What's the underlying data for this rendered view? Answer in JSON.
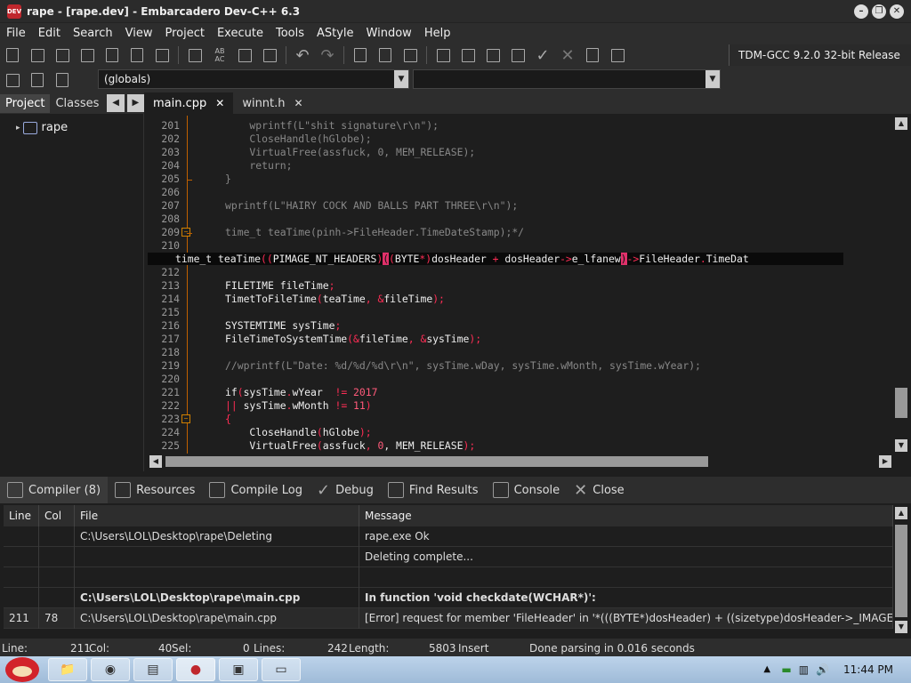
{
  "window": {
    "title": "rape - [rape.dev] - Embarcadero Dev-C++ 6.3",
    "app_icon_text": "DEV C++"
  },
  "menu": [
    "File",
    "Edit",
    "Search",
    "View",
    "Project",
    "Execute",
    "Tools",
    "AStyle",
    "Window",
    "Help"
  ],
  "toolbar": {
    "compiler": "TDM-GCC 9.2.0 32-bit Release",
    "scope_combo": "(globals)"
  },
  "left_panel": {
    "tabs": [
      "Project",
      "Classes"
    ],
    "tree_root": "rape"
  },
  "editor": {
    "tabs": [
      {
        "label": "main.cpp",
        "active": true
      },
      {
        "label": "winnt.h",
        "active": false
      }
    ],
    "lines": [
      {
        "n": "201",
        "t": "    wprintf(L\"shit signature\\r\\n\");",
        "cls": "cm"
      },
      {
        "n": "202",
        "t": "    CloseHandle(hGlobe);",
        "cls": "cm"
      },
      {
        "n": "203",
        "t": "    VirtualFree(assfuck, 0, MEM_RELEASE);",
        "cls": "cm"
      },
      {
        "n": "204",
        "t": "    return;",
        "cls": "cm"
      },
      {
        "n": "205",
        "t": "}",
        "cls": "cm"
      },
      {
        "n": "206",
        "t": "",
        "cls": "cm"
      },
      {
        "n": "207",
        "t": "wprintf(L\"HAIRY COCK AND BALLS PART THREE\\r\\n\");",
        "cls": "cm"
      },
      {
        "n": "208",
        "t": "",
        "cls": "cm"
      },
      {
        "n": "209",
        "t": "time_t teaTime(pinh->FileHeader.TimeDateStamp);*/",
        "cls": "cm"
      },
      {
        "n": "210",
        "t": "",
        "cls": ""
      },
      {
        "n": "211",
        "t": "",
        "cls": "hl"
      },
      {
        "n": "212",
        "t": "",
        "cls": ""
      },
      {
        "n": "213",
        "t": "",
        "cls": ""
      },
      {
        "n": "214",
        "t": "",
        "cls": ""
      },
      {
        "n": "215",
        "t": "",
        "cls": ""
      },
      {
        "n": "216",
        "t": "",
        "cls": ""
      },
      {
        "n": "217",
        "t": "",
        "cls": ""
      },
      {
        "n": "218",
        "t": "",
        "cls": ""
      },
      {
        "n": "219",
        "t": "//wprintf(L\"Date: %d/%d/%d\\r\\n\", sysTime.wDay, sysTime.wMonth, sysTime.wYear);",
        "cls": "cm"
      },
      {
        "n": "220",
        "t": "",
        "cls": ""
      },
      {
        "n": "221",
        "t": "",
        "cls": ""
      },
      {
        "n": "222",
        "t": "",
        "cls": ""
      },
      {
        "n": "223",
        "t": "",
        "cls": ""
      },
      {
        "n": "224",
        "t": "",
        "cls": ""
      },
      {
        "n": "225",
        "t": "",
        "cls": ""
      }
    ],
    "line211": {
      "p1": "time_t teaTime",
      "p2": "((",
      "p3": "PIMAGE_NT_HEADERS",
      "p4": ")",
      "p5": "(",
      "p6": "(",
      "p7": "BYTE",
      "p8": "*)",
      "p9": "dosHeader ",
      "p10": "+",
      "p11": " dosHeader",
      "p12": "->",
      "p13": "e_lfanew",
      "p14": ")",
      "p15": "->",
      "p16": "FileHeader",
      "p17": ".",
      "p18": "TimeDat"
    },
    "line213": {
      "a": "FILETIME fileTime",
      "b": ";"
    },
    "line214": {
      "a": "TimetToFileTime",
      "b": "(",
      "c": "teaTime",
      "d": ", &",
      "e": "fileTime",
      "f": ");"
    },
    "line216": {
      "a": "SYSTEMTIME sysTime",
      "b": ";"
    },
    "line217": {
      "a": "FileTimeToSystemTime",
      "b": "(&",
      "c": "fileTime",
      "d": ", &",
      "e": "sysTime",
      "f": ");"
    },
    "line221": {
      "a": "if",
      "b": "(",
      "c": "sysTime",
      "d": ".",
      "e": "wYear  ",
      "f": "!=",
      "g": " 2017"
    },
    "line222": {
      "a": "||",
      "b": " sysTime",
      "c": ".",
      "d": "wMonth ",
      "e": "!=",
      "f": " 11",
      "g": ")"
    },
    "line223": {
      "a": "{"
    },
    "line224": {
      "a": "    CloseHandle",
      "b": "(",
      "c": "hGlobe",
      "d": ");"
    },
    "line225": {
      "a": "    VirtualFree",
      "b": "(",
      "c": "assfuck",
      "d": ", ",
      "e": "0",
      "f": ", MEM_RELEASE",
      "g": ");"
    }
  },
  "bottom_tabs": [
    "Compiler (8)",
    "Resources",
    "Compile Log",
    "Debug",
    "Find Results",
    "Console",
    "Close"
  ],
  "messages": {
    "headers": [
      "Line",
      "Col",
      "File",
      "Message"
    ],
    "rows": [
      {
        "line": "",
        "col": "",
        "file": "C:\\Users\\LOL\\Desktop\\rape\\Deleting",
        "msg": "rape.exe Ok",
        "bold": false
      },
      {
        "line": "",
        "col": "",
        "file": "",
        "msg": "Deleting complete...",
        "bold": false
      },
      {
        "line": "",
        "col": "",
        "file": "",
        "msg": "",
        "bold": false
      },
      {
        "line": "",
        "col": "",
        "file": "C:\\Users\\LOL\\Desktop\\rape\\main.cpp",
        "msg": "In function 'void checkdate(WCHAR*)':",
        "bold": true
      },
      {
        "line": "211",
        "col": "78",
        "file": "C:\\Users\\LOL\\Desktop\\rape\\main.cpp",
        "msg": "[Error] request for member 'FileHeader' in '*(((BYTE*)dosHeader) + ((sizetype)dosHeader->_IMAGE_DO...",
        "bold": false
      }
    ]
  },
  "status": {
    "line_label": "Line:",
    "line_val": "211",
    "col_label": "Col:",
    "col_val": "40",
    "sel_label": "Sel:",
    "sel_val": "0",
    "lines_label": "Lines:",
    "lines_val": "242",
    "length_label": "Length:",
    "length_val": "5803",
    "mode": "Insert",
    "parse": "Done parsing in 0.016 seconds"
  },
  "taskbar": {
    "clock": "11:44 PM"
  },
  "colors": {
    "accent_red": "#ff2d55",
    "fold": "#c06000",
    "bg": "#1e1e1e"
  }
}
